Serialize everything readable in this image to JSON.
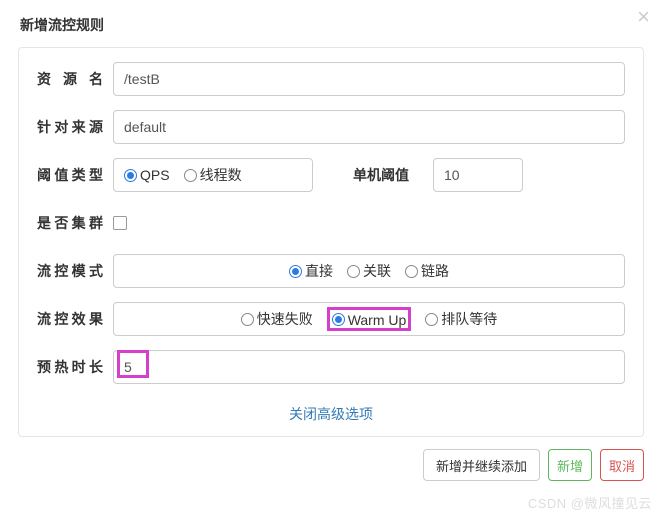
{
  "header": {
    "title": "新增流控规则"
  },
  "form": {
    "resourceName": {
      "label": "资源名",
      "value": "/testB"
    },
    "source": {
      "label": "针对来源",
      "value": "default"
    },
    "thresholdType": {
      "label": "阈值类型",
      "options": [
        {
          "label": "QPS",
          "checked": true
        },
        {
          "label": "线程数",
          "checked": false
        }
      ]
    },
    "singleThreshold": {
      "label": "单机阈值",
      "value": "10"
    },
    "cluster": {
      "label": "是否集群",
      "checked": false
    },
    "mode": {
      "label": "流控模式",
      "options": [
        {
          "label": "直接",
          "checked": true
        },
        {
          "label": "关联",
          "checked": false
        },
        {
          "label": "链路",
          "checked": false
        }
      ]
    },
    "effect": {
      "label": "流控效果",
      "options": [
        {
          "label": "快速失败",
          "checked": false
        },
        {
          "label": "Warm Up",
          "checked": true,
          "highlighted": true
        },
        {
          "label": "排队等待",
          "checked": false
        }
      ]
    },
    "warmup": {
      "label": "预热时长",
      "value": "5",
      "highlighted": true
    },
    "collapseLink": "关闭高级选项"
  },
  "footer": {
    "addContinue": "新增并继续添加",
    "add": "新增",
    "cancel": "取消"
  },
  "watermark": "CSDN @微风撞见云"
}
